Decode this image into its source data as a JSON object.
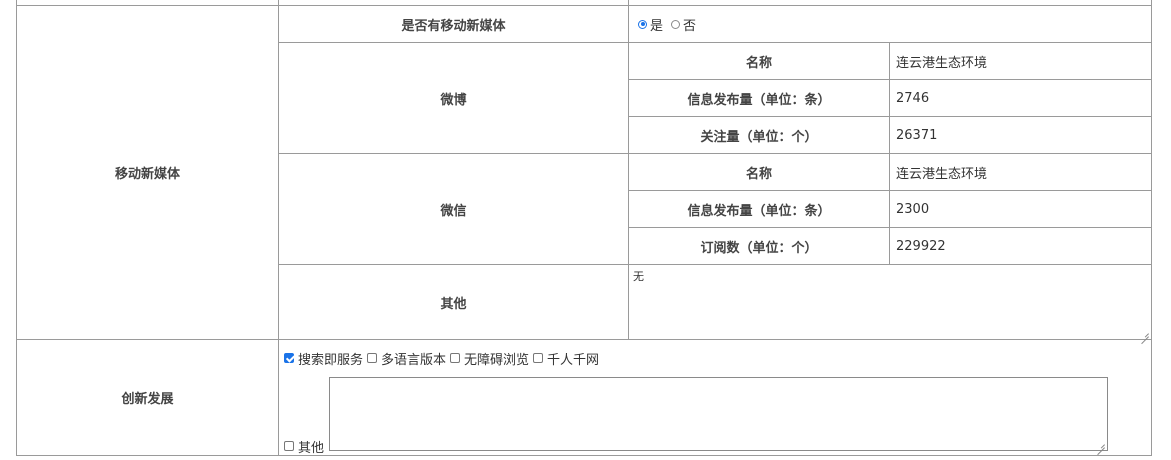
{
  "mobile_media": {
    "section_label": "移动新媒体",
    "has_media_label": "是否有移动新媒体",
    "radio_yes": "是",
    "radio_no": "否",
    "radio_selected": "yes",
    "weibo": {
      "label": "微博",
      "name_label": "名称",
      "name_value": "连云港生态环境",
      "posts_label": "信息发布量（单位：条）",
      "posts_value": "2746",
      "follow_label": "关注量（单位：个）",
      "follow_value": "26371"
    },
    "wechat": {
      "label": "微信",
      "name_label": "名称",
      "name_value": "连云港生态环境",
      "posts_label": "信息发布量（单位：条）",
      "posts_value": "2300",
      "subs_label": "订阅数（单位：个）",
      "subs_value": "229922"
    },
    "other": {
      "label": "其他",
      "text": "无"
    }
  },
  "innovation": {
    "section_label": "创新发展",
    "options": [
      {
        "label": "搜索即服务",
        "checked": true
      },
      {
        "label": "多语言版本",
        "checked": false
      },
      {
        "label": "无障碍浏览",
        "checked": false
      },
      {
        "label": "千人千网",
        "checked": false
      }
    ],
    "other_label": "其他",
    "other_checked": false,
    "other_text": ""
  },
  "colors": {
    "border": "#9a9a9a",
    "accent": "#1a73e8"
  }
}
